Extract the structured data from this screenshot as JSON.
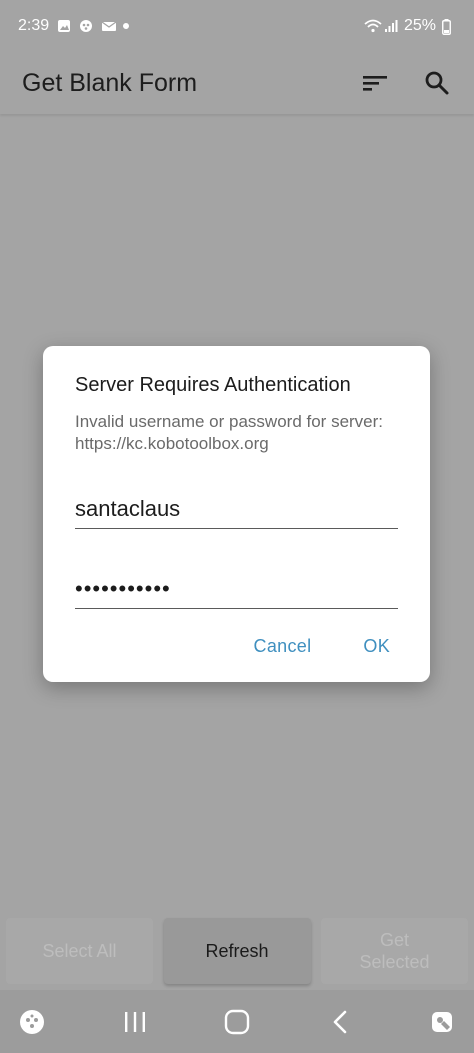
{
  "status_bar": {
    "time": "2:39",
    "battery": "25%"
  },
  "app_bar": {
    "title": "Get Blank Form"
  },
  "dialog": {
    "title": "Server Requires Authentication",
    "message": "Invalid username or password for server: https://kc.kobotoolbox.org",
    "username_value": "santaclaus",
    "password_value": "•••••••••••",
    "cancel_label": "Cancel",
    "ok_label": "OK"
  },
  "bottom_actions": {
    "select_all_label": "Select All",
    "refresh_label": "Refresh",
    "get_selected_label": "Get Selected"
  },
  "colors": {
    "accent": "#3f8fbf",
    "scrim": "#a4a4a4"
  }
}
